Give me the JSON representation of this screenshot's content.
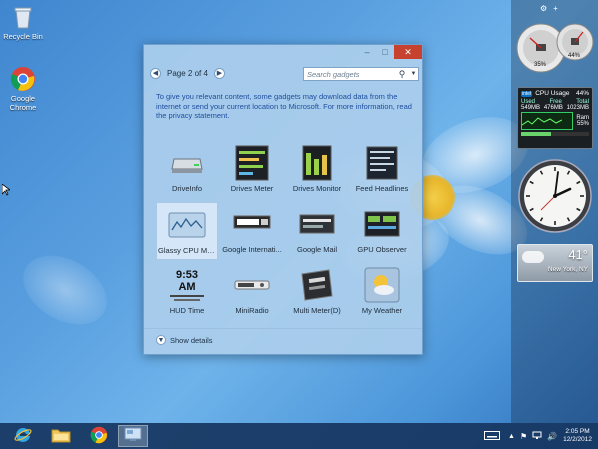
{
  "desktop": {
    "icons": [
      {
        "label": "Recycle Bin",
        "icon": "recycle-bin-icon"
      },
      {
        "label": "Google Chrome",
        "icon": "chrome-icon"
      }
    ]
  },
  "gadget_window": {
    "pager": {
      "label": "Page 2 of 4"
    },
    "search": {
      "placeholder": "Search gadgets"
    },
    "info_text": "To give you relevant content, some gadgets may download data from the internet or send your current location to Microsoft. For more information, read the privacy statement.",
    "gadgets": [
      {
        "label": "DriveInfo"
      },
      {
        "label": "Drives Meter"
      },
      {
        "label": "Drives Monitor"
      },
      {
        "label": "Feed Headlines"
      },
      {
        "label": "Glassy CPU Mo..."
      },
      {
        "label": "Google Internati..."
      },
      {
        "label": "Google Mail"
      },
      {
        "label": "GPU Observer"
      },
      {
        "label": "HUD Time",
        "time_text": "9:53 AM"
      },
      {
        "label": "MiniRadio"
      },
      {
        "label": "Multi Meter(D)"
      },
      {
        "label": "My Weather"
      }
    ],
    "show_details": "Show details"
  },
  "sidebar": {
    "meter": {
      "left_value": "35%",
      "right_value": "44%"
    },
    "cpu": {
      "title": "CPU Usage",
      "percent": "44%",
      "used_label": "Used",
      "free_label": "Free",
      "total_label": "Total",
      "used": "549MB",
      "free": "476MB",
      "total": "1023MB",
      "ram_label": "Ram",
      "ram": "55%"
    },
    "weather": {
      "temp": "41°",
      "location": "New York, NY"
    }
  },
  "taskbar": {
    "buttons": [
      {
        "name": "ie-button",
        "icon": "ie-icon"
      },
      {
        "name": "file-explorer-button",
        "icon": "folder-icon"
      },
      {
        "name": "chrome-button",
        "icon": "chrome-icon"
      },
      {
        "name": "gadgets-button",
        "icon": "gadget-icon"
      }
    ],
    "clock": {
      "time": "2:05 PM",
      "date": "12/2/2012"
    }
  }
}
